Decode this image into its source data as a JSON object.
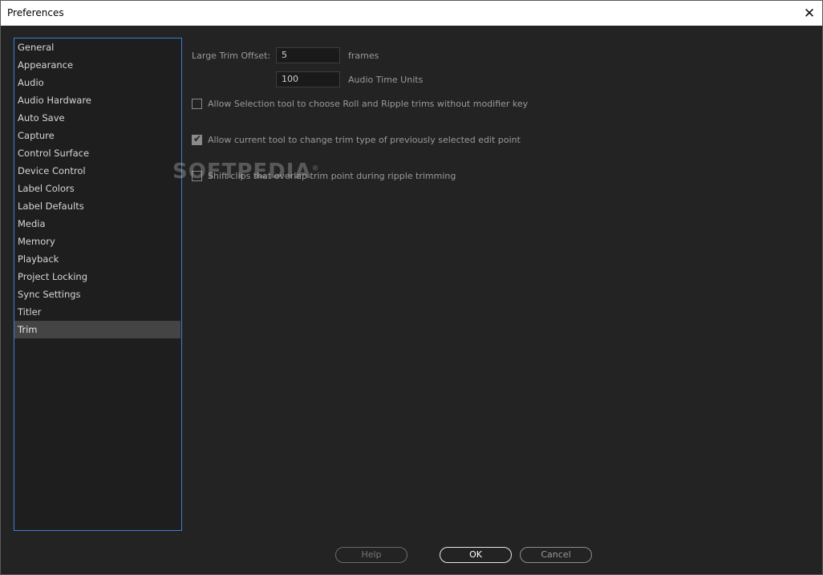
{
  "window": {
    "title": "Preferences"
  },
  "sidebar": {
    "items": [
      "General",
      "Appearance",
      "Audio",
      "Audio Hardware",
      "Auto Save",
      "Capture",
      "Control Surface",
      "Device Control",
      "Label Colors",
      "Label Defaults",
      "Media",
      "Memory",
      "Playback",
      "Project Locking",
      "Sync Settings",
      "Titler",
      "Trim"
    ],
    "selected": "Trim"
  },
  "trim": {
    "large_trim_offset_label": "Large Trim Offset:",
    "frames_value": "5",
    "frames_unit": "frames",
    "audio_value": "100",
    "audio_unit": "Audio Time Units",
    "opt_selection_roll_ripple": {
      "label": "Allow Selection tool to choose Roll and Ripple trims without modifier key",
      "checked": false
    },
    "opt_change_trim_type": {
      "label": "Allow current tool to change trim type of previously selected edit point",
      "checked": true
    },
    "opt_shift_clips": {
      "label": "Shift clips that overlap trim point during ripple trimming",
      "checked": false
    }
  },
  "watermark": {
    "text": "SOFTPEDIA",
    "mark": "®"
  },
  "buttons": {
    "help": "Help",
    "ok": "OK",
    "cancel": "Cancel"
  },
  "icons": {
    "close": "close-icon",
    "check": "check-icon"
  }
}
